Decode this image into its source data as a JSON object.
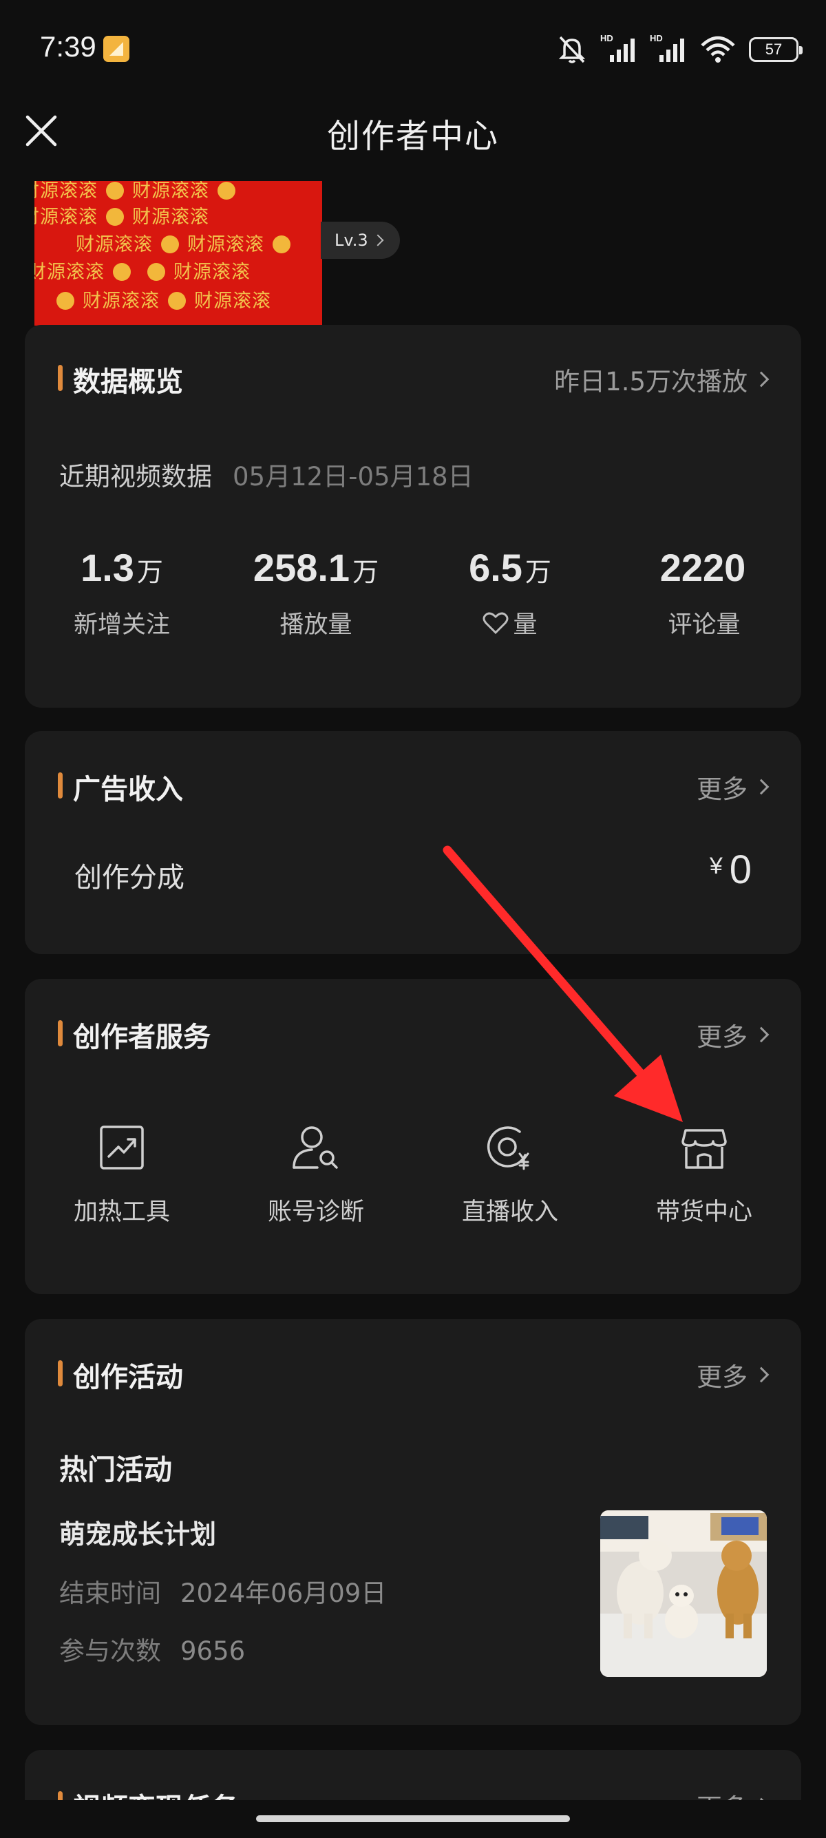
{
  "status_bar": {
    "time": "7:39",
    "hd_label": "HD",
    "battery": "57"
  },
  "header": {
    "title": "创作者中心"
  },
  "profile": {
    "banner_text": "财源滚滚",
    "level": "Lv.3"
  },
  "data_overview": {
    "title": "数据概览",
    "more_label": "昨日1.5万次播放",
    "range_label": "近期视频数据",
    "range_dates": "05月12日-05月18日",
    "stats": [
      {
        "value": "1.3",
        "unit": "万",
        "label": "新增关注"
      },
      {
        "value": "258.1",
        "unit": "万",
        "label": "播放量"
      },
      {
        "value": "6.5",
        "unit": "万",
        "label": "量",
        "icon": "heart-icon"
      },
      {
        "value": "2220",
        "unit": "",
        "label": "评论量"
      }
    ]
  },
  "ad_income": {
    "title": "广告收入",
    "more_label": "更多",
    "row_label": "创作分成",
    "currency": "¥",
    "amount": "0"
  },
  "creator_services": {
    "title": "创作者服务",
    "more_label": "更多",
    "items": [
      {
        "label": "加热工具",
        "icon": "trend-chart-icon"
      },
      {
        "label": "账号诊断",
        "icon": "user-search-icon"
      },
      {
        "label": "直播收入",
        "icon": "live-yen-icon"
      },
      {
        "label": "带货中心",
        "icon": "store-icon"
      }
    ]
  },
  "creator_activity": {
    "title": "创作活动",
    "more_label": "更多",
    "section_label": "热门活动",
    "activity_name": "萌宠成长计划",
    "end_label": "结束时间",
    "end_value": "2024年06月09日",
    "count_label": "参与次数",
    "count_value": "9656"
  },
  "video_tasks": {
    "title": "视频变现任务",
    "more_label": "更多"
  },
  "colors": {
    "accent": "#e08a3c",
    "annotation_arrow": "#ff2a2a",
    "banner_red": "#d8170f"
  }
}
